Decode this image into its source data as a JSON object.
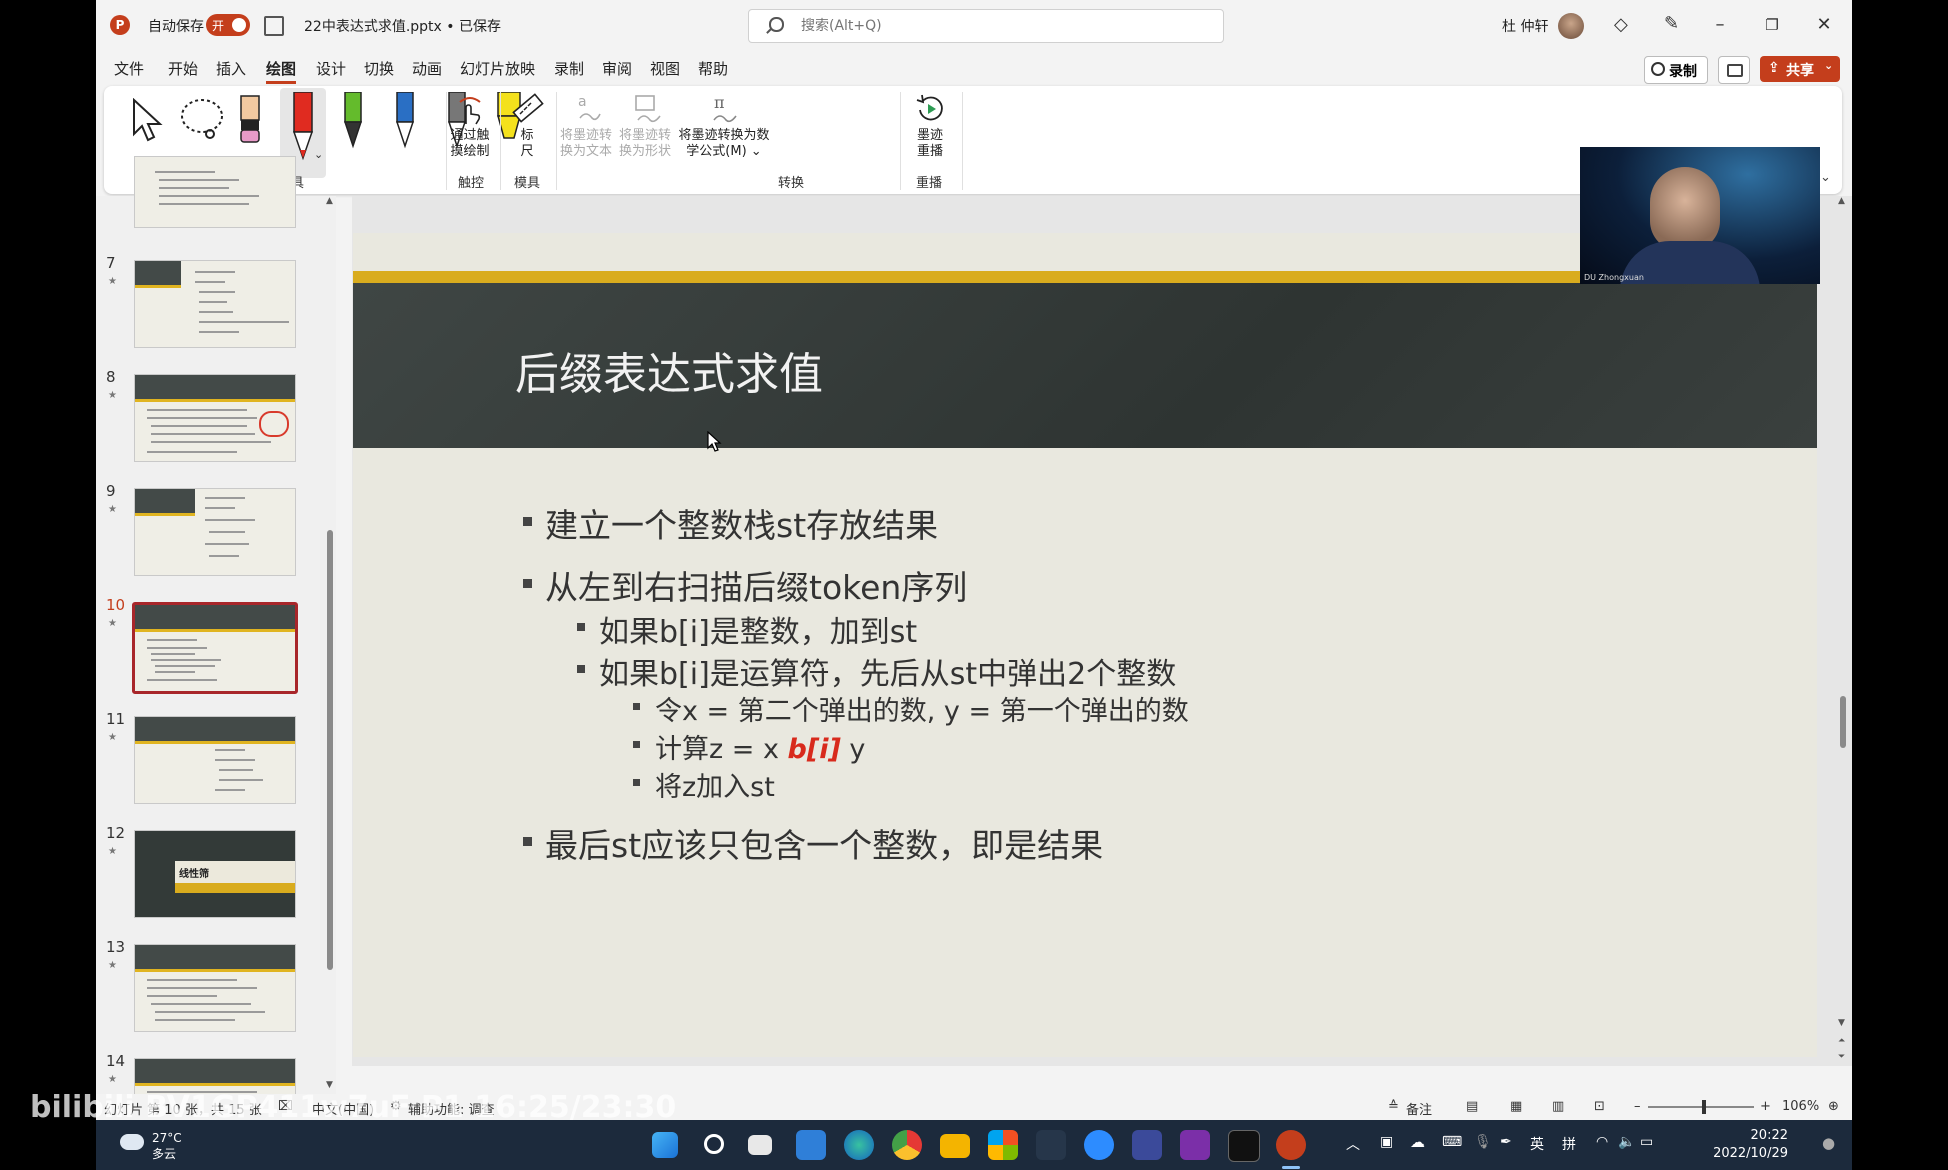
{
  "app": {
    "autosave_label": "自动保存",
    "autosave_state": "开",
    "file_title": "22中表达式求值.pptx • 已保存",
    "search_placeholder": "搜索(Alt+Q)",
    "user_name": "杜 仲轩",
    "accent_color": "#c43e1c"
  },
  "menu": {
    "items": [
      "文件",
      "开始",
      "插入",
      "绘图",
      "设计",
      "切换",
      "动画",
      "幻灯片放映",
      "录制",
      "审阅",
      "视图",
      "帮助"
    ],
    "active": "绘图",
    "record_label": "录制",
    "share_label": "共享"
  },
  "ribbon": {
    "groups": {
      "drawing_tools": "绘图工具",
      "touch": "触控",
      "stencils": "模具",
      "convert": "转换",
      "replay": "重播"
    },
    "touch_draw": [
      "通过触",
      "摸绘制"
    ],
    "ruler": [
      "标",
      "尺"
    ],
    "ink_to_text": [
      "将墨迹转",
      "换为文本"
    ],
    "ink_to_shape": [
      "将墨迹转",
      "换为形状"
    ],
    "ink_to_math": [
      "将墨迹转换为数",
      "学公式(M) ⌄"
    ],
    "ink_replay": [
      "墨迹",
      "重播"
    ]
  },
  "thumbnails": {
    "numbers": [
      "7",
      "8",
      "9",
      "10",
      "11",
      "12",
      "13",
      "14"
    ],
    "selected": "10",
    "slide12_title": "线性筛"
  },
  "slide": {
    "title": "后缀表达式求值",
    "bullets": {
      "b1": "建立一个整数栈st存放结果",
      "b2": "从左到右扫描后缀token序列",
      "b2_1": "如果b[i]是整数，加到st",
      "b2_2": "如果b[i]是运算符，先后从st中弹出2个整数",
      "b2_2_1": "令x = 第二个弹出的数, y = 第一个弹出的数",
      "b2_2_2_pre": "计算z = x ",
      "b2_2_2_op": "b[i]",
      "b2_2_2_post": " y",
      "b2_2_3": "将z加入st",
      "b3": "最后st应该只包含一个整数，即是结果"
    }
  },
  "webcam": {
    "label": "DU Zhongxuan"
  },
  "status": {
    "slide_info": "幻灯片 第 10 张，共 15 张",
    "language": "中文(中国)",
    "accessibility": "辅助功能: 调查",
    "notes": "备注",
    "zoom": "106%"
  },
  "taskbar": {
    "temperature": "27°C",
    "weather": "多云",
    "time": "20:22",
    "date": "2022/10/29",
    "ime_lang": "英",
    "ime_mode": "拼"
  },
  "overlay": {
    "watermark": "bilibili BV1GP411w7uF P1 16:25/23:30"
  }
}
